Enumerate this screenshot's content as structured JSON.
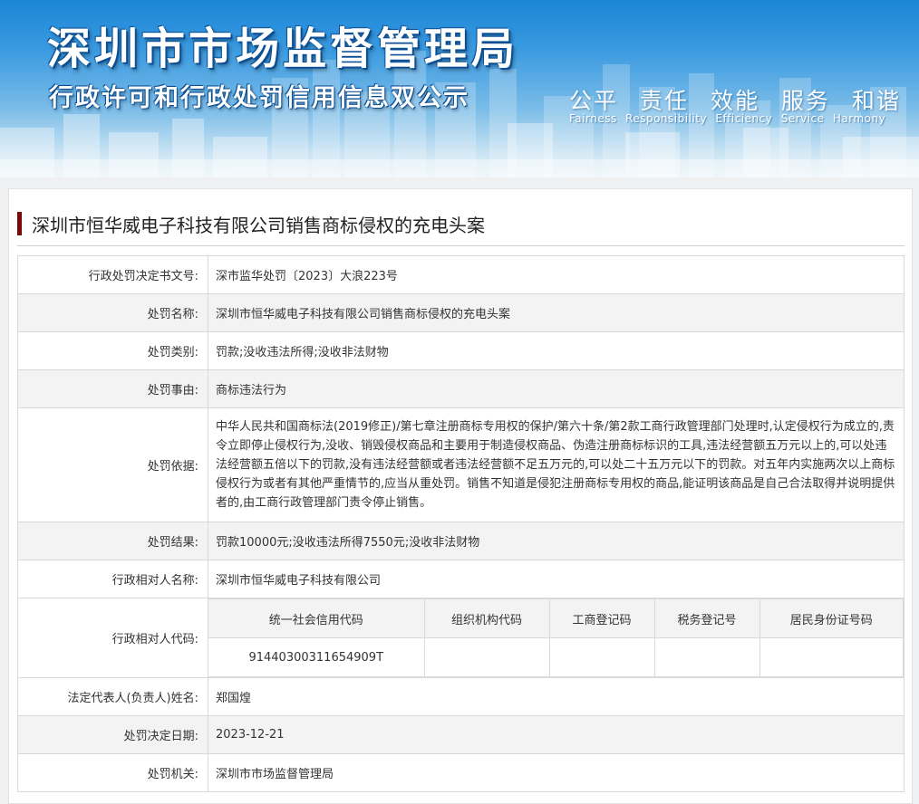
{
  "banner": {
    "title": "深圳市市场监督管理局",
    "subtitle": "行政许可和行政处罚信用信息双公示",
    "slogan_cn": [
      "公平",
      "责任",
      "效能",
      "服务",
      "和谐"
    ],
    "slogan_en": [
      "Fairness",
      "Responsibility",
      "Efficiency",
      "Service",
      "Harmony"
    ]
  },
  "case_title": "深圳市恒华威电子科技有限公司销售商标侵权的充电头案",
  "fields": {
    "decision_no": {
      "label": "行政处罚决定书文号:",
      "value": "深市监华处罚〔2023〕大浪223号"
    },
    "penalty_name": {
      "label": "处罚名称:",
      "value": "深圳市恒华威电子科技有限公司销售商标侵权的充电头案"
    },
    "penalty_type": {
      "label": "处罚类别:",
      "value": "罚款;没收违法所得;没收非法财物"
    },
    "penalty_reason": {
      "label": "处罚事由:",
      "value": "商标违法行为"
    },
    "penalty_basis": {
      "label": "处罚依据:",
      "value": "中华人民共和国商标法(2019修正)/第七章注册商标专用权的保护/第六十条/第2款工商行政管理部门处理时,认定侵权行为成立的,责令立即停止侵权行为,没收、销毁侵权商品和主要用于制造侵权商品、伪造注册商标标识的工具,违法经营额五万元以上的,可以处违法经营额五倍以下的罚款,没有违法经营额或者违法经营额不足五万元的,可以处二十五万元以下的罚款。对五年内实施两次以上商标侵权行为或者有其他严重情节的,应当从重处罚。销售不知道是侵犯注册商标专用权的商品,能证明该商品是自己合法取得并说明提供者的,由工商行政管理部门责令停止销售。"
    },
    "penalty_result": {
      "label": "处罚结果:",
      "value": "罚款10000元;没收违法所得7550元;没收非法财物"
    },
    "party_name": {
      "label": "行政相对人名称:",
      "value": "深圳市恒华威电子科技有限公司"
    },
    "party_code": {
      "label": "行政相对人代码:",
      "headers": [
        "统一社会信用代码",
        "组织机构代码",
        "工商登记码",
        "税务登记号",
        "居民身份证号码"
      ],
      "values": [
        "91440300311654909T",
        "",
        "",
        "",
        ""
      ]
    },
    "legal_rep": {
      "label": "法定代表人(负责人)姓名:",
      "value": "郑国煌"
    },
    "decision_date": {
      "label": "处罚决定日期:",
      "value": "2023-12-21"
    },
    "authority": {
      "label": "处罚机关:",
      "value": "深圳市市场监督管理局"
    }
  }
}
